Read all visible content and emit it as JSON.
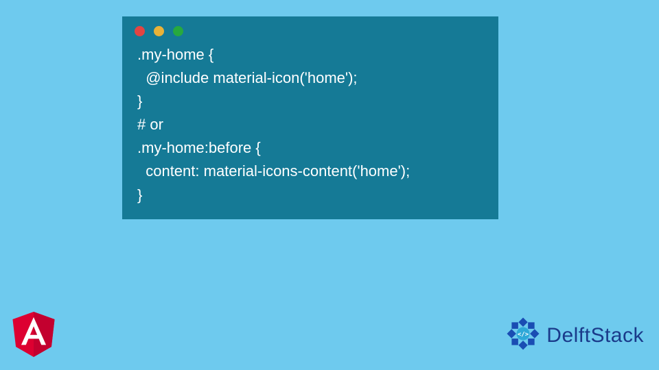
{
  "code": {
    "line1": ".my-home {",
    "line2": "  @include material-icon('home');",
    "line3": "}",
    "line4": "# or",
    "line5": ".my-home:before {",
    "line6": "  content: material-icons-content('home');",
    "line7": "}"
  },
  "brand": {
    "name": "DelftStack"
  }
}
